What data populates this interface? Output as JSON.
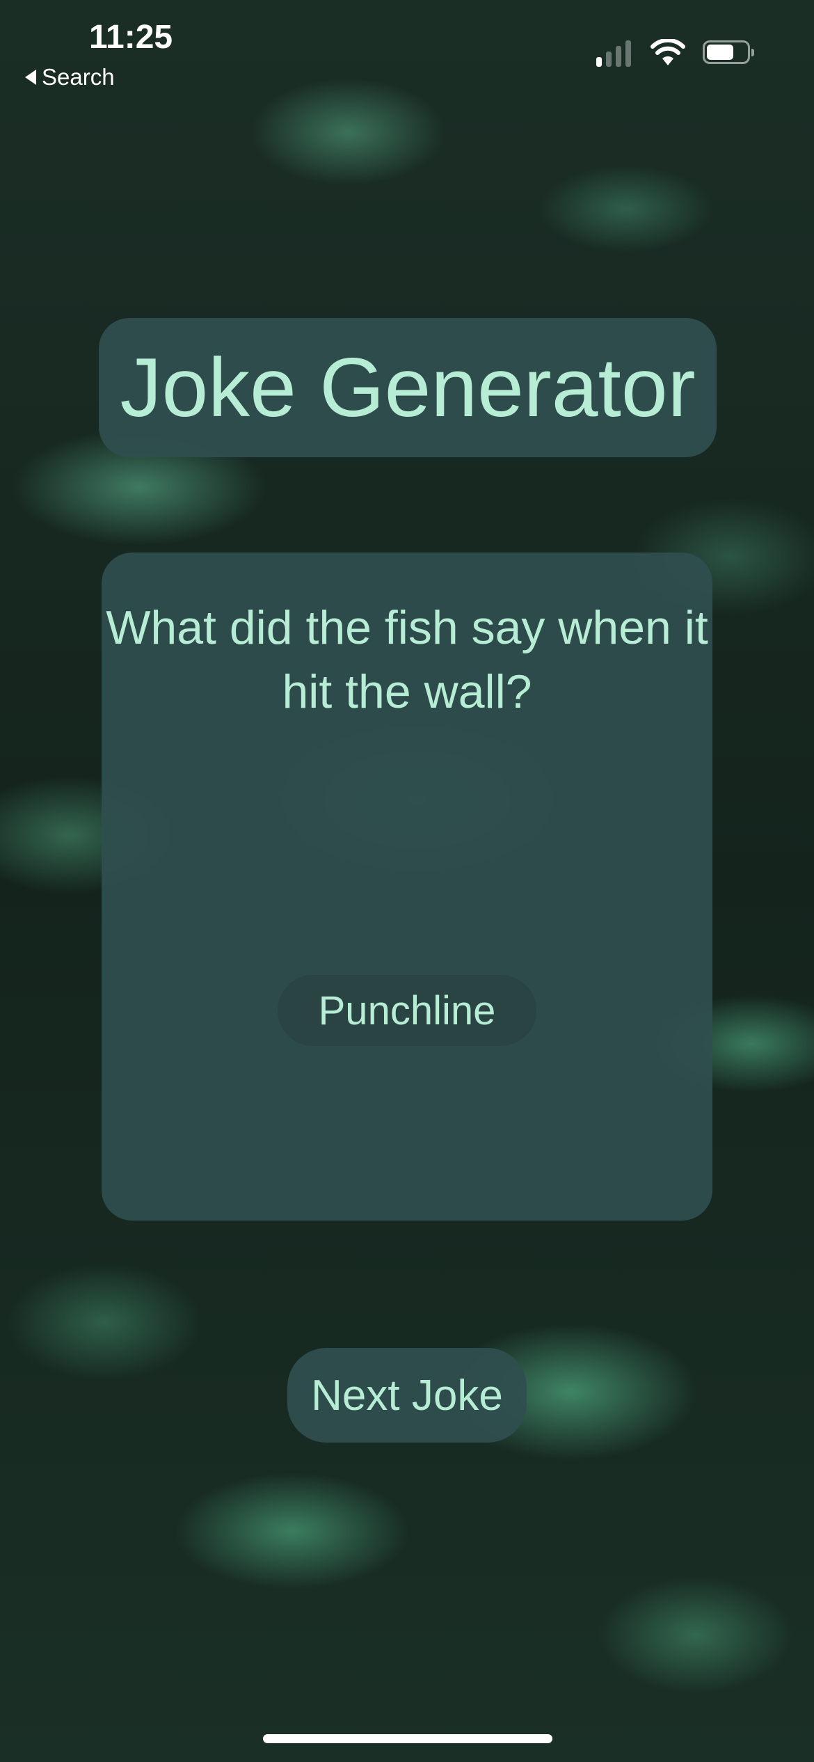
{
  "status_bar": {
    "time": "11:25",
    "back_label": "Search",
    "icons": [
      "cellular-signal-icon",
      "wifi-icon",
      "battery-icon"
    ]
  },
  "header": {
    "title": "Joke Generator"
  },
  "joke": {
    "setup": "What did the fish say when it hit the wall?",
    "punchline_button": "Punchline"
  },
  "actions": {
    "next_joke": "Next Joke"
  },
  "colors": {
    "panel": "#2F4F4F",
    "text": "#B7ECD5"
  }
}
